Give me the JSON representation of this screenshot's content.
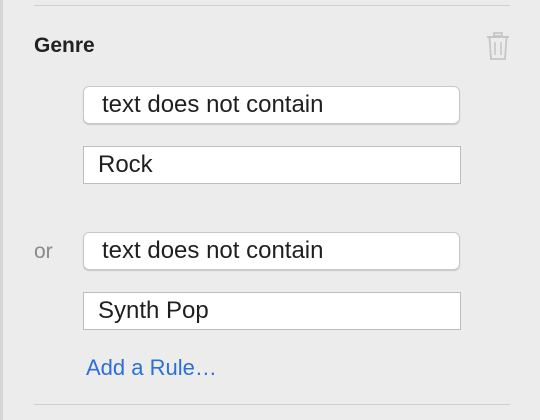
{
  "section": {
    "title": "Genre",
    "delete_icon": "trash-icon"
  },
  "rules": [
    {
      "condition": "text does not contain",
      "value": "Rock"
    },
    {
      "connector": "or",
      "condition": "text does not contain",
      "value": "Synth Pop"
    }
  ],
  "add_rule_label": "Add a Rule…",
  "colors": {
    "link": "#2c6fd6",
    "panel": "#ececec"
  }
}
